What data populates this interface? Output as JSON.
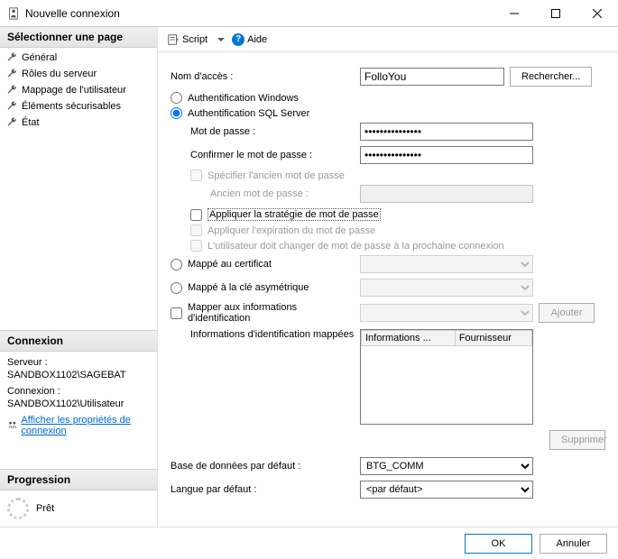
{
  "window": {
    "title": "Nouvelle connexion"
  },
  "toolbar": {
    "script": "Script",
    "help": "Aide"
  },
  "sidebar": {
    "select_page_title": "Sélectionner une page",
    "items": [
      {
        "label": "Général"
      },
      {
        "label": "Rôles du serveur"
      },
      {
        "label": "Mappage de l'utilisateur"
      },
      {
        "label": "Éléments sécurisables"
      },
      {
        "label": "État"
      }
    ],
    "connection_title": "Connexion",
    "server_label": "Serveur :",
    "server_value": "SANDBOX1102\\SAGEBAT",
    "connection_label": "Connexion :",
    "connection_value": "SANDBOX1102\\Utilisateur",
    "view_props_link": "Afficher les propriétés de connexion",
    "progress_title": "Progression",
    "progress_status": "Prêt"
  },
  "form": {
    "login_name_label": "Nom d'accès :",
    "login_name_value": "FolloYou",
    "search_btn": "Rechercher...",
    "auth_windows": "Authentification Windows",
    "auth_sql": "Authentification SQL Server",
    "password_label": "Mot de passe :",
    "password_value": "•••••••••••••••",
    "confirm_password_label": "Confirmer le mot de passe :",
    "confirm_password_value": "•••••••••••••••",
    "specify_old_label": "Spécifier l'ancien mot de passe",
    "old_password_label": "Ancien mot de passe :",
    "enforce_policy_label": "Appliquer la stratégie de mot de passe",
    "enforce_expiration_label": "Appliquer l'expiration du mot de passe",
    "must_change_label": "L'utilisateur doit changer de mot de passe à la prochaine connexion",
    "mapped_cert_label": "Mappé au certificat",
    "mapped_asym_label": "Mappé à la clé asymétrique",
    "map_credentials_label": "Mapper aux informations d'identification",
    "add_btn": "Ajouter",
    "mapped_credentials_label": "Informations d'identification mappées",
    "table_col1": "Informations ...",
    "table_col2": "Fournisseur",
    "remove_btn": "Supprimer",
    "default_db_label": "Base de données par défaut :",
    "default_db_value": "BTG_COMM",
    "default_lang_label": "Langue par défaut :",
    "default_lang_value": "<par défaut>"
  },
  "footer": {
    "ok": "OK",
    "cancel": "Annuler"
  }
}
